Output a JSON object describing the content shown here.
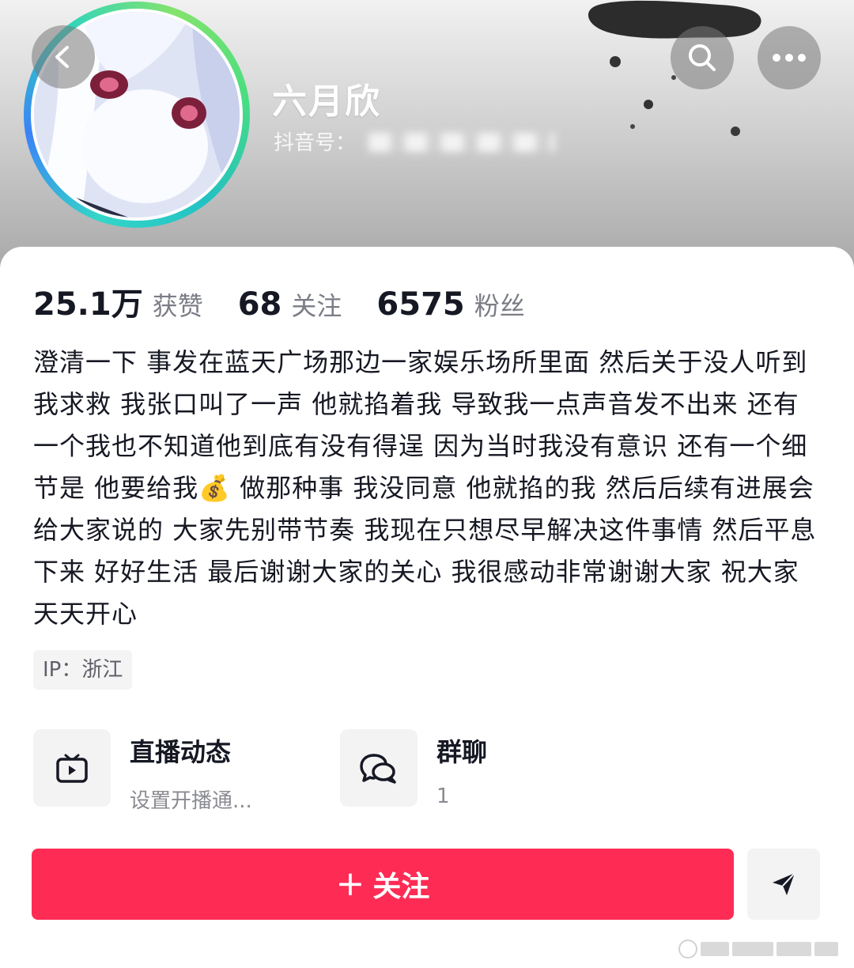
{
  "profile": {
    "nickname": "六月欣",
    "douyin_id_label": "抖音号："
  },
  "stats": [
    {
      "value": "25.1万",
      "label": "获赞"
    },
    {
      "value": "68",
      "label": "关注"
    },
    {
      "value": "6575",
      "label": "粉丝"
    }
  ],
  "bio": "澄清一下 事发在蓝天广场那边一家娱乐场所里面 然后关于没人听到我求救 我张口叫了一声 他就掐着我 导致我一点声音发不出来 还有一个我也不知道他到底有没有得逞 因为当时我没有意识 还有一个细节是 他要给我💰 做那种事 我没同意 他就掐的我 然后后续有进展会给大家说的 大家先别带节奏 我现在只想尽早解决这件事情 然后平息下来 好好生活 最后谢谢大家的关心 我很感动非常谢谢大家 祝大家天天开心",
  "ip": "IP：浙江",
  "features": [
    {
      "title": "直播动态",
      "subtitle": "设置开播通...",
      "icon": "tv-icon"
    },
    {
      "title": "群聊",
      "subtitle": "1",
      "icon": "chat-bubbles-icon"
    }
  ],
  "actions": {
    "follow_plus": "+",
    "follow_label": "关注"
  },
  "icons": {
    "back": "back-arrow-icon",
    "search": "search-icon",
    "more": "more-dots-icon",
    "share": "send-icon"
  },
  "colors": {
    "accent": "#fe2c55",
    "text_primary": "#161823",
    "text_secondary": "#7b7d86"
  }
}
